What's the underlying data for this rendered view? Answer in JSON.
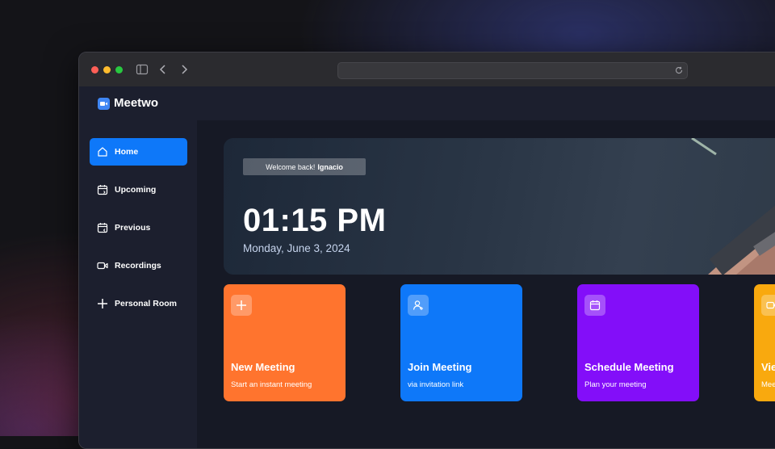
{
  "app": {
    "name": "Meetwo"
  },
  "sidebar": {
    "items": [
      {
        "label": "Home",
        "icon": "home-icon",
        "active": true
      },
      {
        "label": "Upcoming",
        "icon": "calendar-upcoming-icon"
      },
      {
        "label": "Previous",
        "icon": "calendar-previous-icon"
      },
      {
        "label": "Recordings",
        "icon": "video-icon"
      },
      {
        "label": "Personal Room",
        "icon": "plus-icon"
      }
    ]
  },
  "hero": {
    "welcome_prefix": "Welcome back!",
    "user_name": "Ignacio",
    "time": "01:15 PM",
    "date": "Monday, June 3, 2024"
  },
  "cards": [
    {
      "title": "New Meeting",
      "subtitle": "Start an instant meeting",
      "icon": "plus-icon",
      "color": "#ff742e"
    },
    {
      "title": "Join Meeting",
      "subtitle": "via invitation link",
      "icon": "user-add-icon",
      "color": "#0e78f9"
    },
    {
      "title": "Schedule Meeting",
      "subtitle": "Plan your meeting",
      "icon": "calendar-icon",
      "color": "#830ef9"
    },
    {
      "title": "View Recordings",
      "subtitle": "Meeting recordings",
      "icon": "video-icon",
      "color": "#f9a90e"
    }
  ],
  "colors": {
    "accent": "#0e78f9",
    "sidebar_bg": "#1c1f2e",
    "main_bg": "#161925"
  }
}
